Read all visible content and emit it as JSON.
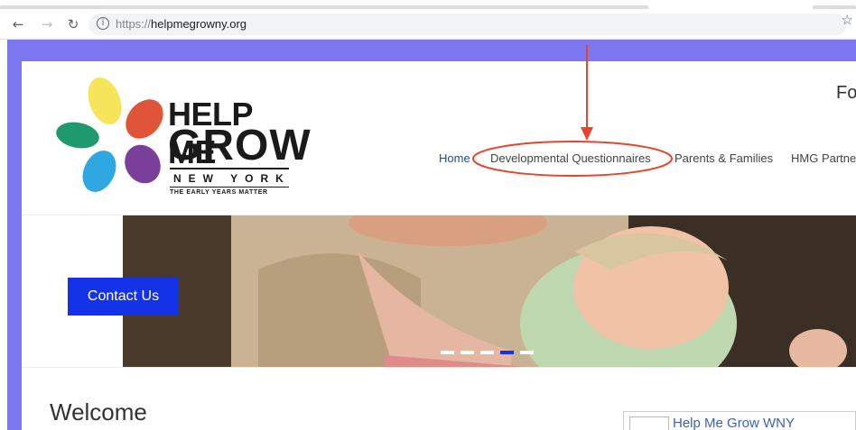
{
  "browser": {
    "url_scheme": "https://",
    "url_host": "helpmegrowny.org",
    "back_icon": "arrow-left-icon",
    "forward_icon": "arrow-right-icon",
    "reload_icon": "reload-icon",
    "info_icon": "info-icon",
    "bookmark_icon": "star-icon"
  },
  "site": {
    "logo": {
      "line1": "HELP ME",
      "line2": "GROW",
      "line3": "NEW YORK",
      "tagline": "THE EARLY YEARS MATTER"
    },
    "header_partial_text": "Fo",
    "nav": [
      {
        "label": "Home",
        "active": true
      },
      {
        "label": "Developmental Questionnaires",
        "active": false
      },
      {
        "label": "Parents & Families",
        "active": false
      },
      {
        "label": "HMG Partne",
        "active": false
      }
    ],
    "hero": {
      "button_label": "Contact Us",
      "slide_count": 5,
      "active_slide": 4
    },
    "welcome_heading": "Welcome",
    "widget_title": "Help Me Grow WNY"
  },
  "colors": {
    "page_background": "#7b78f0",
    "contact_button": "#1433e8",
    "nav_active": "#1a4ba8",
    "annotation": "#e8442a",
    "petal_yellow": "#f6e45a",
    "petal_orange": "#e0553a",
    "petal_green": "#1f9a6e",
    "petal_blue": "#2fa7e0",
    "petal_purple": "#7a3f9a"
  }
}
